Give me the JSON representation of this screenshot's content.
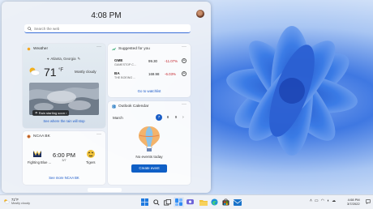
{
  "panel": {
    "clock": "4:08 PM",
    "search_placeholder": "Search the web"
  },
  "weather": {
    "title": "Weather",
    "location": "Atlanta, Georgia",
    "temperature": "71",
    "unit": "°F",
    "condition": "Mostly cloudy",
    "map_badge": "Rain starting soon",
    "link": "See where the rain will stop"
  },
  "stocks": {
    "title": "Suggested for you",
    "items": [
      {
        "symbol": "GME",
        "name": "GAMESTOP C...",
        "price": "99.30",
        "change": "-11.07%"
      },
      {
        "symbol": "BA",
        "name": "THE BOEING ...",
        "price": "169.98",
        "change": "-6.03%"
      }
    ],
    "add_glyph": "+",
    "link": "Go to watchlist"
  },
  "calendar": {
    "title": "Outlook Calendar",
    "month": "March",
    "days": [
      "7",
      "8",
      "9"
    ],
    "empty_text": "No events today",
    "button": "Create event"
  },
  "ncaa": {
    "title": "NCAA BK",
    "time": "6:00 PM",
    "date": "3/7",
    "team1": "Fighting Blue ...",
    "team2": "Tigers",
    "link": "See more NCAA BK"
  },
  "taskbar": {
    "weather_temp": "71°F",
    "weather_cond": "Mostly cloudy",
    "time": "4:08 PM",
    "date": "3/7/2022",
    "apps": [
      "start-icon",
      "search-icon",
      "task-view-icon",
      "widgets-icon",
      "chat-icon",
      "file-explorer-icon",
      "edge-icon",
      "store-icon",
      "mail-icon"
    ]
  },
  "colors": {
    "accent": "#0f5fc6",
    "negative": "#c4262e",
    "link": "#1c5ac9"
  }
}
